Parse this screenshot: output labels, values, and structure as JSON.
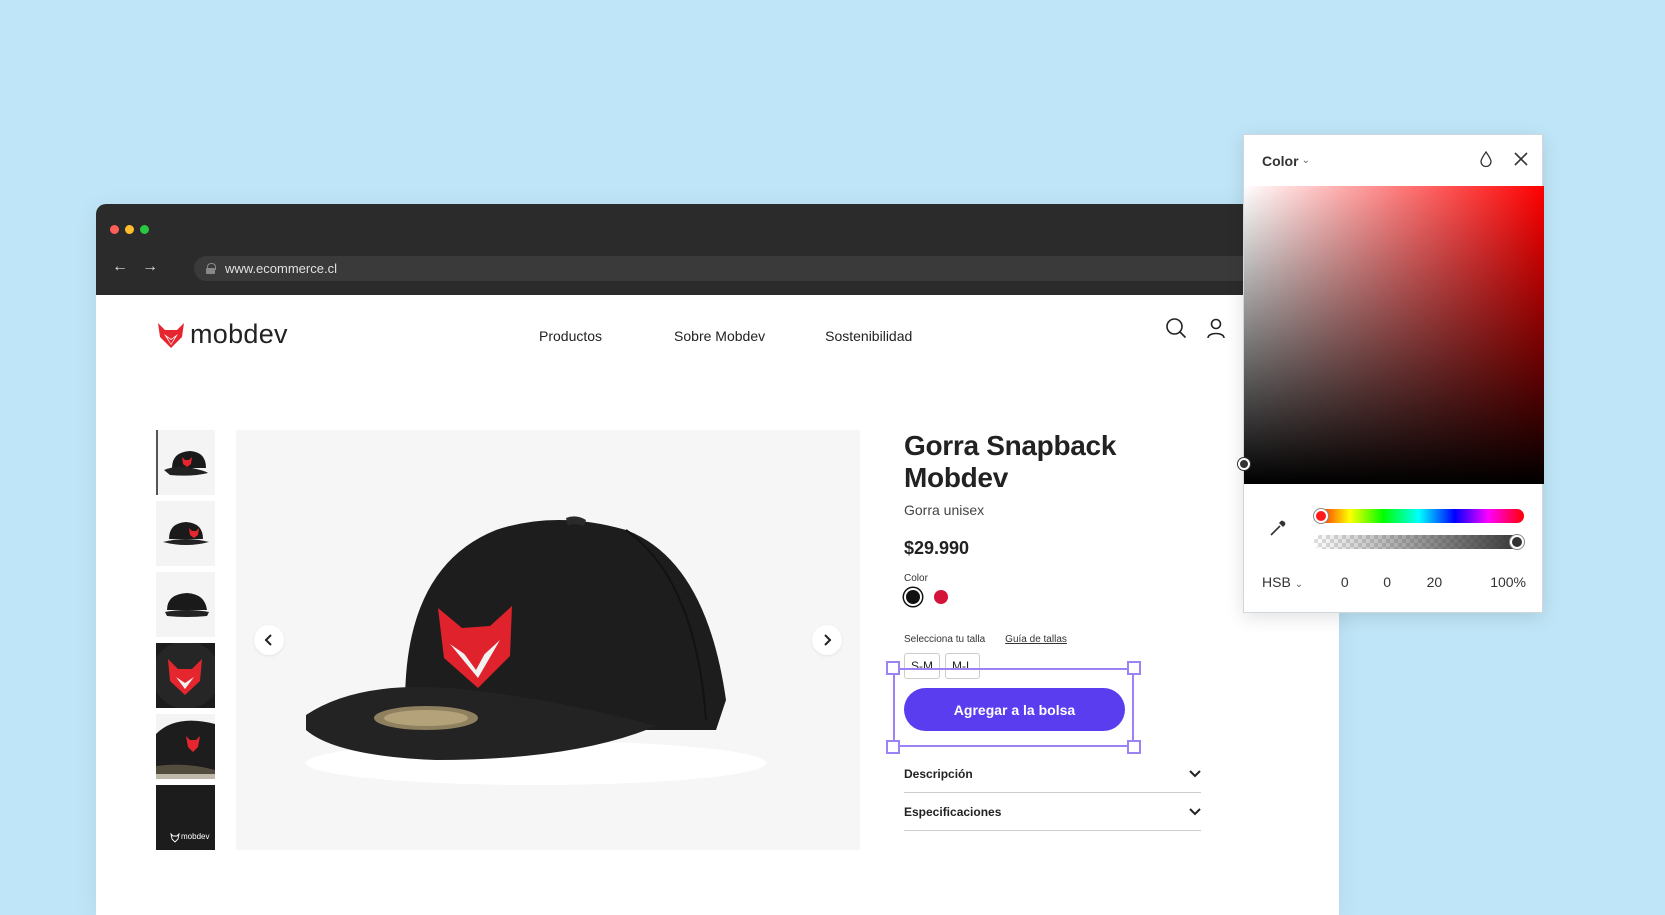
{
  "browser": {
    "url": "www.ecommerce.cl",
    "dot_colors": [
      "#ff5f57",
      "#febc2e",
      "#28c840"
    ]
  },
  "header": {
    "logo_text": "mobdev",
    "menu": [
      "Productos",
      "Sobre Mobdev",
      "Sostenibilidad"
    ],
    "icons": [
      "search-icon",
      "user-icon"
    ]
  },
  "product": {
    "title": "Gorra Snapback Mobdev",
    "subtitle": "Gorra unisex",
    "price": "$29.990",
    "color_label": "Color",
    "colors": [
      "#111111",
      "#d4143a"
    ],
    "size_label": "Selecciona tu talla",
    "size_guide": "Guía de tallas",
    "sizes": [
      "S-M",
      "M-L"
    ],
    "add_button": "Agregar a la bolsa",
    "accordion": [
      "Descripción",
      "Especificaciones"
    ],
    "thumb_logo_text": "mobdev"
  },
  "picker": {
    "title": "Color",
    "mode": "HSB",
    "values": [
      "0",
      "0",
      "20",
      "100%"
    ],
    "accent": "#5b3df0",
    "selection_color": "#9c82f5"
  }
}
